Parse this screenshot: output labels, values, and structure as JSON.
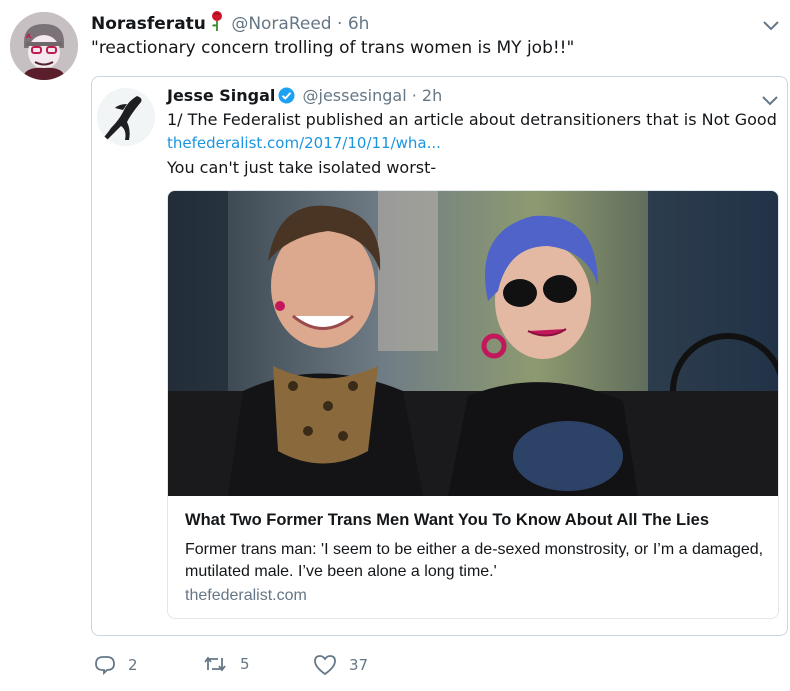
{
  "tweet": {
    "author_name": "Norasferatu",
    "author_handle": "@NoraReed",
    "separator": "·",
    "time": "6h",
    "text": "\"reactionary concern trolling of trans women is MY job!!\"",
    "avatar_icon": "skull-avatar-icon",
    "rose_icon": "rose-emoji-icon",
    "actions": {
      "reply_count": "2",
      "retweet_count": "5",
      "like_count": "37"
    }
  },
  "quoted": {
    "author_name": "Jesse Singal",
    "author_handle": "@jessesingal",
    "separator": "·",
    "time": "2h",
    "line1": "1/ The Federalist published an article about detransitioners that is Not Good",
    "link": "thefederalist.com/2017/10/11/wha...",
    "line3": "You can't just take isolated worst-",
    "card": {
      "title": "What Two Former Trans Men Want You To Know About All The Lies",
      "description": "Former trans man: 'I seem to be either a de-sexed monstrosity, or I’m a damaged, mutilated male. I’ve been alone a long time.'",
      "domain": "thefederalist.com"
    }
  },
  "colors": {
    "link": "#1b95e0",
    "muted": "#657786",
    "verified": "#1da1f2",
    "border": "#ccd6dd"
  }
}
